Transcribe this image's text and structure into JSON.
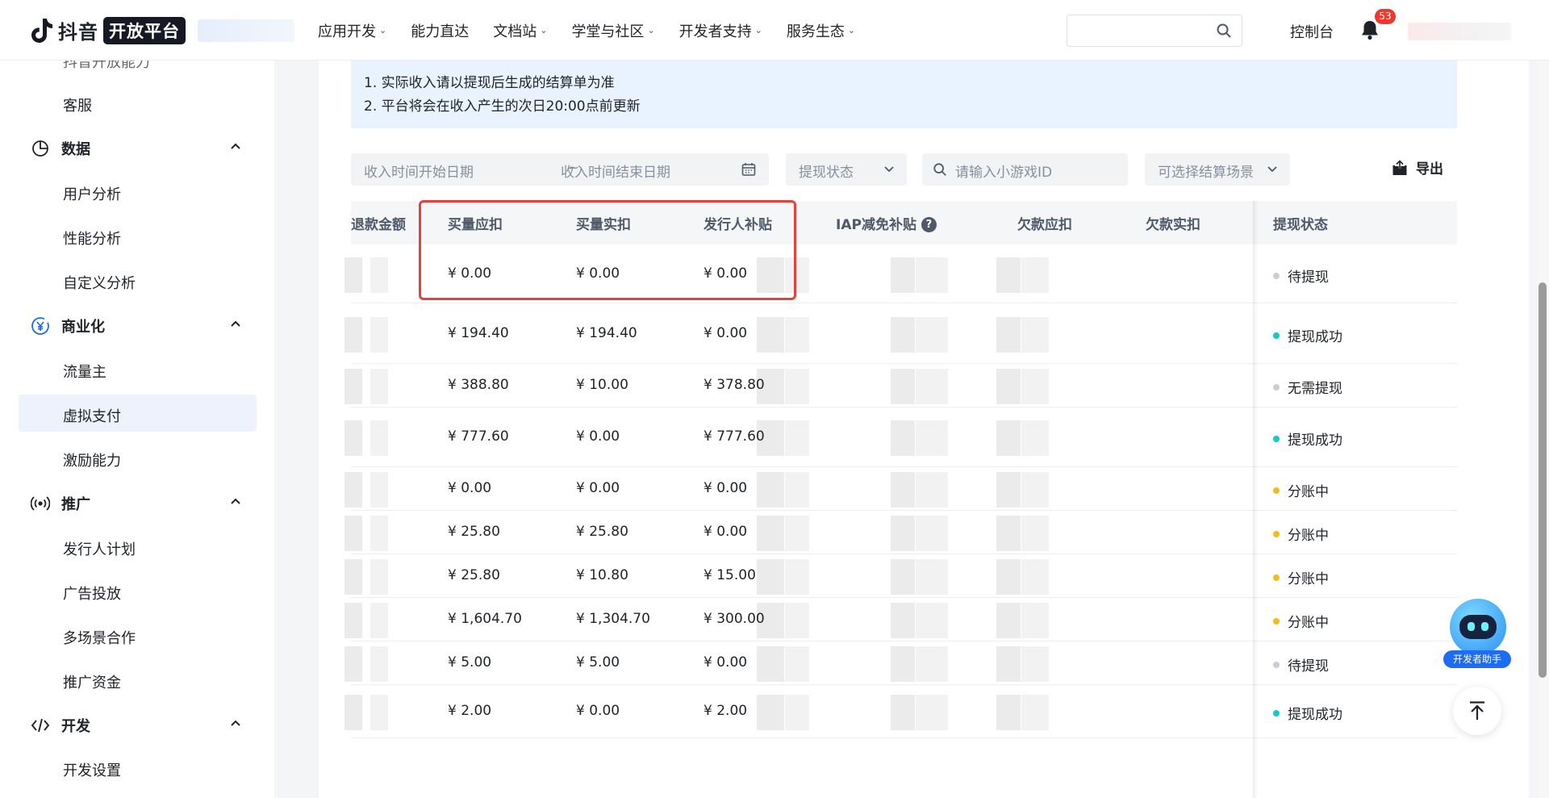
{
  "header": {
    "logo_text": "抖音",
    "logo_badge": "开放平台",
    "nav": [
      {
        "label": "应用开发",
        "has_menu": true
      },
      {
        "label": "能力直达",
        "has_menu": false
      },
      {
        "label": "文档站",
        "has_menu": true
      },
      {
        "label": "学堂与社区",
        "has_menu": true
      },
      {
        "label": "开发者支持",
        "has_menu": true
      },
      {
        "label": "服务生态",
        "has_menu": true
      }
    ],
    "search_placeholder": "",
    "console_label": "控制台",
    "notification_count": "53"
  },
  "sidebar": {
    "cut_item": "抖音开放能力",
    "items": [
      {
        "type": "sub",
        "label": "客服"
      },
      {
        "type": "group",
        "label": "数据",
        "icon": "pie-chart-icon"
      },
      {
        "type": "sub",
        "label": "用户分析"
      },
      {
        "type": "sub",
        "label": "性能分析"
      },
      {
        "type": "sub",
        "label": "自定义分析"
      },
      {
        "type": "group",
        "label": "商业化",
        "icon": "yen-icon"
      },
      {
        "type": "sub",
        "label": "流量主"
      },
      {
        "type": "sub",
        "label": "虚拟支付",
        "active": true
      },
      {
        "type": "sub",
        "label": "激励能力"
      },
      {
        "type": "group",
        "label": "推广",
        "icon": "broadcast-icon"
      },
      {
        "type": "sub",
        "label": "发行人计划"
      },
      {
        "type": "sub",
        "label": "广告投放"
      },
      {
        "type": "sub",
        "label": "多场景合作"
      },
      {
        "type": "sub",
        "label": "推广资金"
      },
      {
        "type": "group",
        "label": "开发",
        "icon": "code-icon"
      },
      {
        "type": "sub",
        "label": "开发设置"
      }
    ]
  },
  "notice": {
    "lines": [
      "1. 实际收入请以提现后生成的结算单为准",
      "2. 平台将会在收入产生的次日20:00点前更新"
    ]
  },
  "filters": {
    "start_date_placeholder": "收入时间开始日期",
    "range_sep": "~",
    "end_date_placeholder": "收入时间结束日期",
    "status_placeholder": "提现状态",
    "game_id_placeholder": "请输入小游戏ID",
    "scene_placeholder": "可选择结算场景",
    "export_label": "导出"
  },
  "table": {
    "columns": [
      "退款金额",
      "买量应扣",
      "买量实扣",
      "发行人补贴",
      "IAP减免补贴",
      "欠款应扣",
      "欠款实扣",
      "提现状态"
    ],
    "rows": [
      {
        "buy_due": "¥ 0.00",
        "buy_actual": "¥ 0.00",
        "subsidy": "¥ 0.00",
        "status": "待提现",
        "status_color": "#c9cdd4"
      },
      {
        "buy_due": "¥ 194.40",
        "buy_actual": "¥ 194.40",
        "subsidy": "¥ 0.00",
        "status": "提现成功",
        "status_color": "#14c9c9"
      },
      {
        "buy_due": "¥ 388.80",
        "buy_actual": "¥ 10.00",
        "subsidy": "¥ 378.80",
        "status": "无需提现",
        "status_color": "#c9cdd4"
      },
      {
        "buy_due": "¥ 777.60",
        "buy_actual": "¥ 0.00",
        "subsidy": "¥ 777.60",
        "status": "提现成功",
        "status_color": "#14c9c9"
      },
      {
        "buy_due": "¥ 0.00",
        "buy_actual": "¥ 0.00",
        "subsidy": "¥ 0.00",
        "status": "分账中",
        "status_color": "#f7ba1e"
      },
      {
        "buy_due": "¥ 25.80",
        "buy_actual": "¥ 25.80",
        "subsidy": "¥ 0.00",
        "status": "分账中",
        "status_color": "#f7ba1e"
      },
      {
        "buy_due": "¥ 25.80",
        "buy_actual": "¥ 10.80",
        "subsidy": "¥ 15.00",
        "status": "分账中",
        "status_color": "#f7ba1e"
      },
      {
        "buy_due": "¥ 1,604.70",
        "buy_actual": "¥ 1,304.70",
        "subsidy": "¥ 300.00",
        "status": "分账中",
        "status_color": "#f7ba1e"
      },
      {
        "buy_due": "¥ 5.00",
        "buy_actual": "¥ 5.00",
        "subsidy": "¥ 0.00",
        "status": "待提现",
        "status_color": "#c9cdd4"
      },
      {
        "buy_due": "¥ 2.00",
        "buy_actual": "¥ 0.00",
        "subsidy": "¥ 2.00",
        "status": "提现成功",
        "status_color": "#14c9c9"
      }
    ]
  },
  "assistant": {
    "label": "开发者助手"
  },
  "colors": {
    "accent": "#1e6cf2",
    "highlight": "#e8413c",
    "notice_bg": "#e8f3ff"
  }
}
